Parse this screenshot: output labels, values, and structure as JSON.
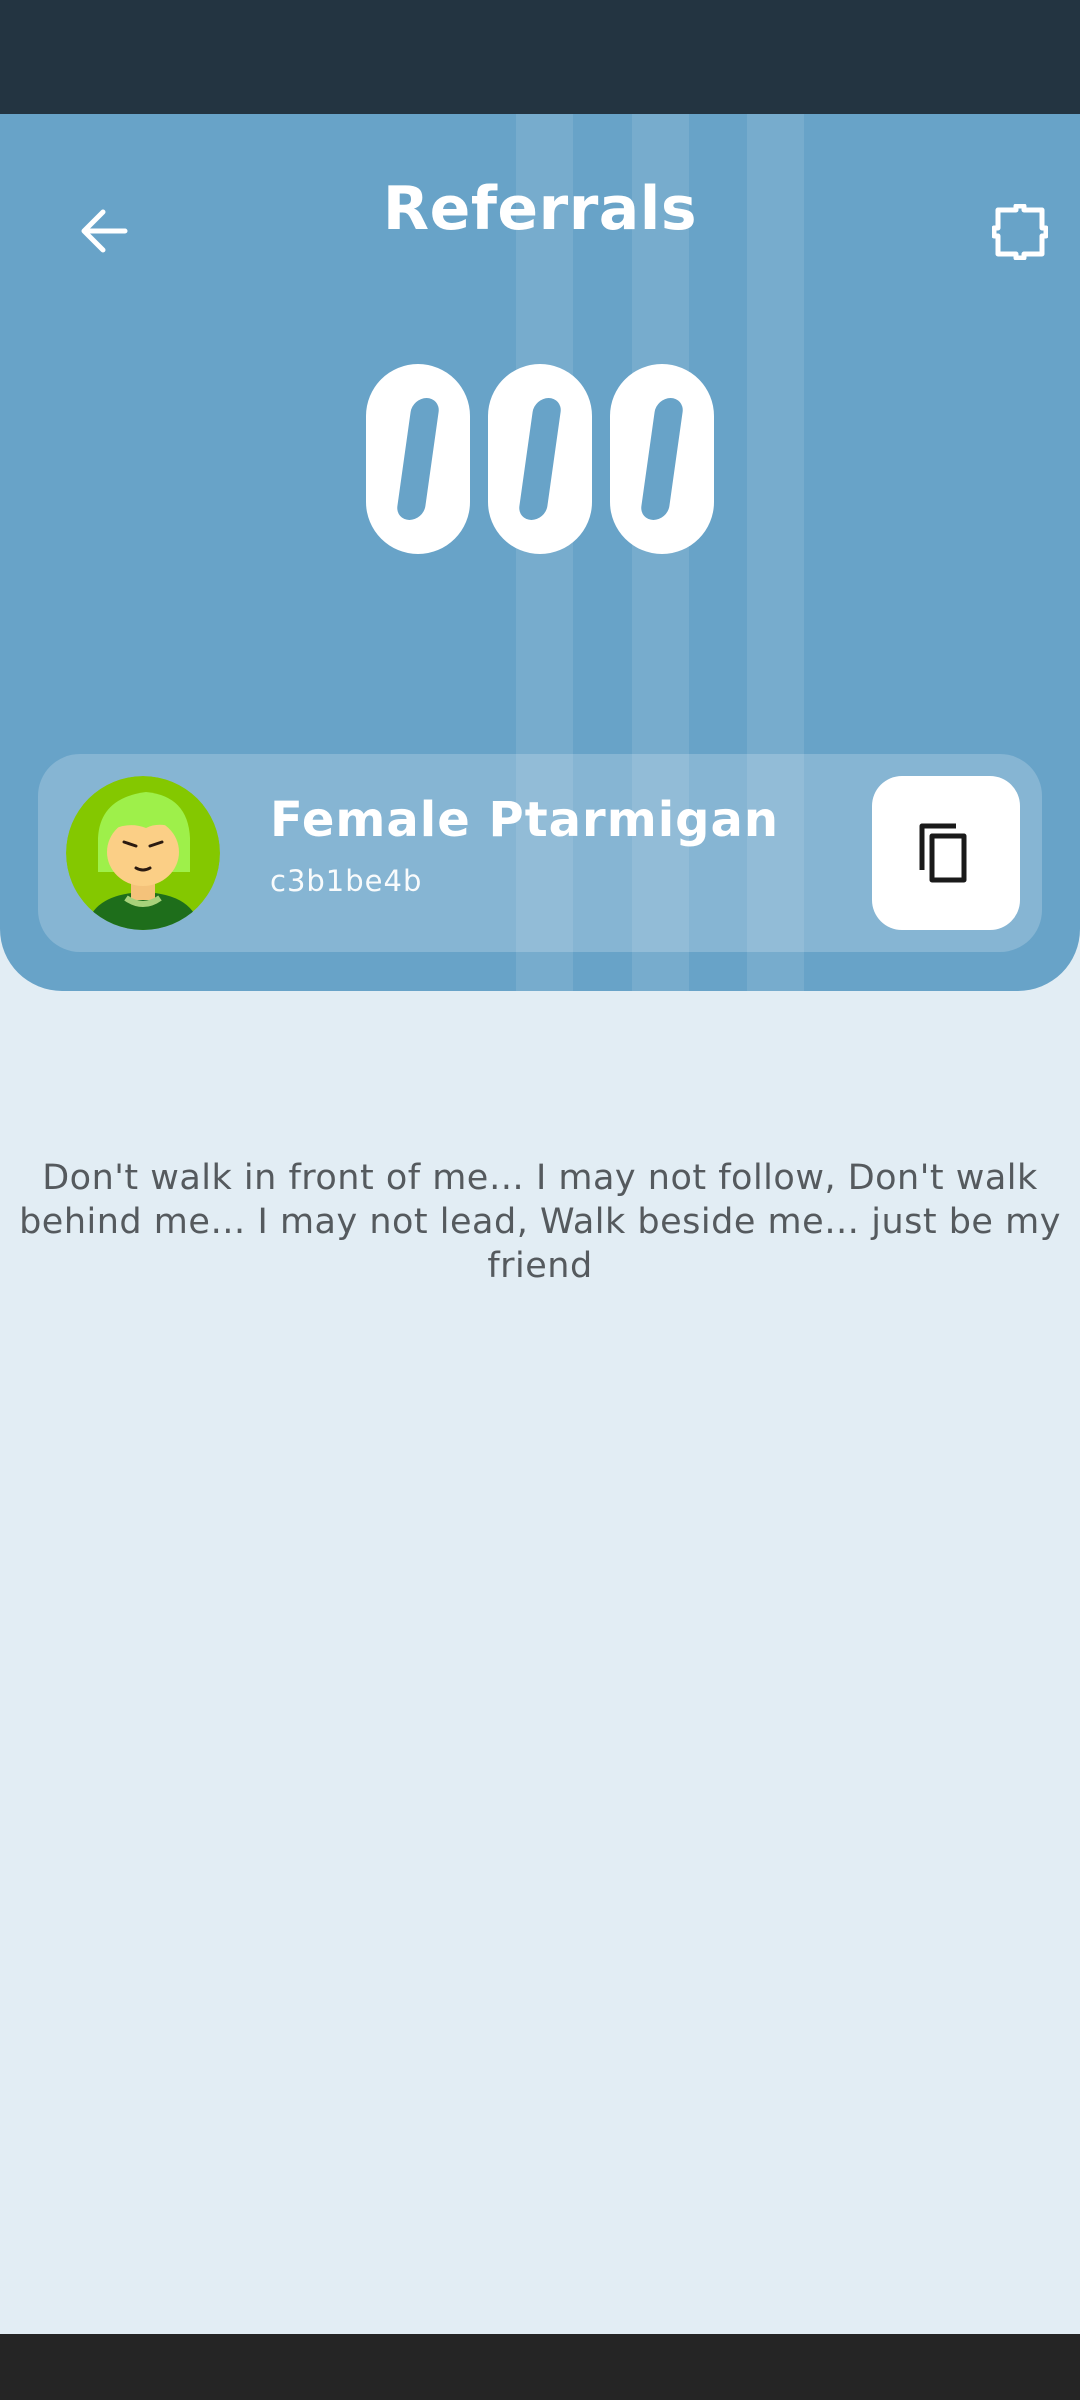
{
  "header": {
    "title": "Referrals"
  },
  "counter": {
    "digits": [
      "0",
      "0",
      "0"
    ]
  },
  "profile": {
    "name": "Female Ptarmigan",
    "code": "c3b1be4b"
  },
  "quote": {
    "text": "Don't walk in front of me… I may not follow, Don't walk behind me… I may not lead, Walk beside me… just be my friend"
  },
  "icons": {
    "back": "arrow-left-icon",
    "scan": "scan-frame-icon",
    "copy": "copy-icon",
    "avatar": "avatar-icon"
  },
  "colors": {
    "status_bar": "#233441",
    "header_bg": "#68a3c8",
    "page_bg": "#e2edf4",
    "nav_bar": "#252525",
    "quote_text": "#555a5e"
  }
}
